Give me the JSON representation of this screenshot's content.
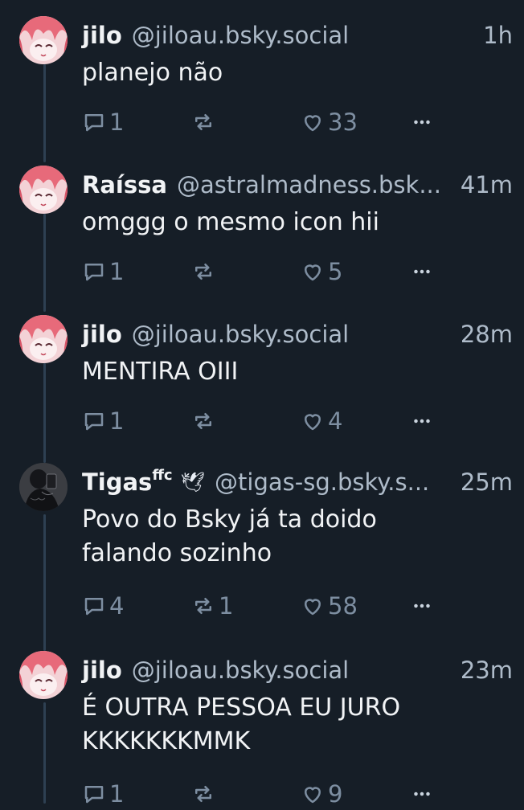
{
  "posts": [
    {
      "name": "jilo",
      "handle": "@jiloau.bsky.social",
      "time": "1h",
      "text": "planejo não",
      "replies": "1",
      "reposts": "",
      "likes": "33",
      "avatar": "pink-anime-avatar"
    },
    {
      "name": "Raíssa",
      "handle": "@astralmadness.bsk...",
      "time": "41m",
      "text": "omggg o mesmo icon hii",
      "replies": "1",
      "reposts": "",
      "likes": "5",
      "avatar": "pink-anime-avatar"
    },
    {
      "name": "jilo",
      "handle": "@jiloau.bsky.social",
      "time": "28m",
      "text": "MENTIRA OIII",
      "replies": "1",
      "reposts": "",
      "likes": "4",
      "avatar": "pink-anime-avatar"
    },
    {
      "name": "Tigas",
      "name_sup": "ffc",
      "emoji": "🕊",
      "handle": "@tigas-sg.bsky.s...",
      "time": "25m",
      "text": "Povo do Bsky já ta doido\nfalando sozinho",
      "replies": "4",
      "reposts": "1",
      "likes": "58",
      "avatar": "photo-avatar"
    },
    {
      "name": "jilo",
      "handle": "@jiloau.bsky.social",
      "time": "23m",
      "text": "É OUTRA PESSOA EU JURO\nKKKKKKKMMK",
      "replies": "1",
      "reposts": "",
      "likes": "9",
      "avatar": "pink-anime-avatar"
    }
  ],
  "icons": {
    "reply": "speech-bubble-icon",
    "repost": "repost-arrows-icon",
    "like": "heart-icon",
    "more": "more-dots-icon"
  },
  "colors": {
    "background": "#161e27",
    "text": "#f1f3f5",
    "muted": "#aebbc9",
    "icon": "#7d8ea1",
    "thread_line": "#2e4052"
  }
}
